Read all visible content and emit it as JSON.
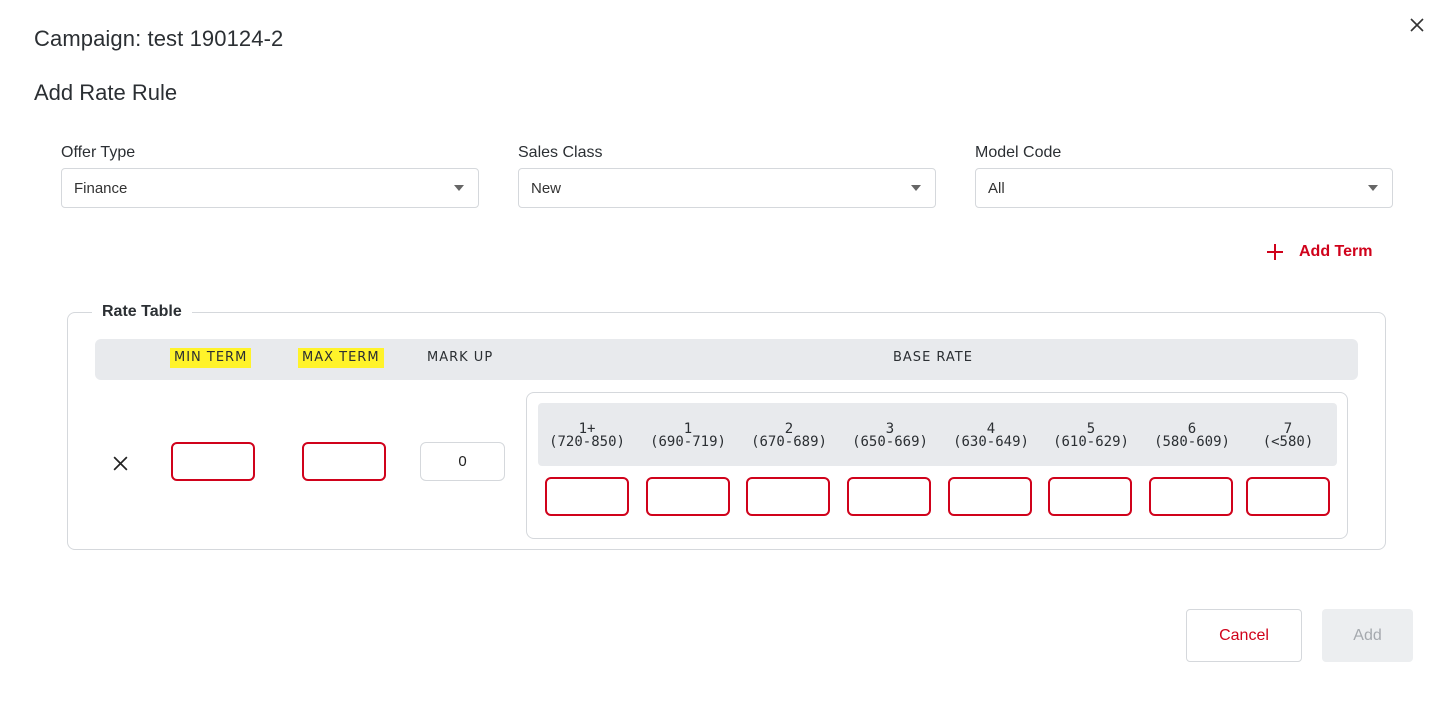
{
  "dialog": {
    "title": "Campaign: test 190124-2",
    "section_title": "Add Rate Rule"
  },
  "filters": [
    {
      "label": "Offer Type",
      "value": "Finance"
    },
    {
      "label": "Sales Class",
      "value": "New"
    },
    {
      "label": "Model Code",
      "value": "All"
    }
  ],
  "add_term_label": "Add Term",
  "rate_table": {
    "legend": "Rate Table",
    "columns": {
      "min_term": "MIN TERM",
      "max_term": "MAX TERM",
      "mark_up": "MARK UP",
      "base_rate": "BASE RATE"
    },
    "row": {
      "min_term": "",
      "max_term": "",
      "mark_up": "0"
    },
    "tiers": [
      {
        "tier": "1+",
        "range": "(720-850)"
      },
      {
        "tier": "1",
        "range": "(690-719)"
      },
      {
        "tier": "2",
        "range": "(670-689)"
      },
      {
        "tier": "3",
        "range": "(650-669)"
      },
      {
        "tier": "4",
        "range": "(630-649)"
      },
      {
        "tier": "5",
        "range": "(610-629)"
      },
      {
        "tier": "6",
        "range": "(580-609)"
      },
      {
        "tier": "7",
        "range": "(<580)"
      }
    ]
  },
  "buttons": {
    "cancel": "Cancel",
    "add": "Add"
  },
  "colors": {
    "accent": "#d0021b",
    "highlight": "#fff32a",
    "header_bg": "#e8eaed",
    "border": "#d5d8dc"
  }
}
